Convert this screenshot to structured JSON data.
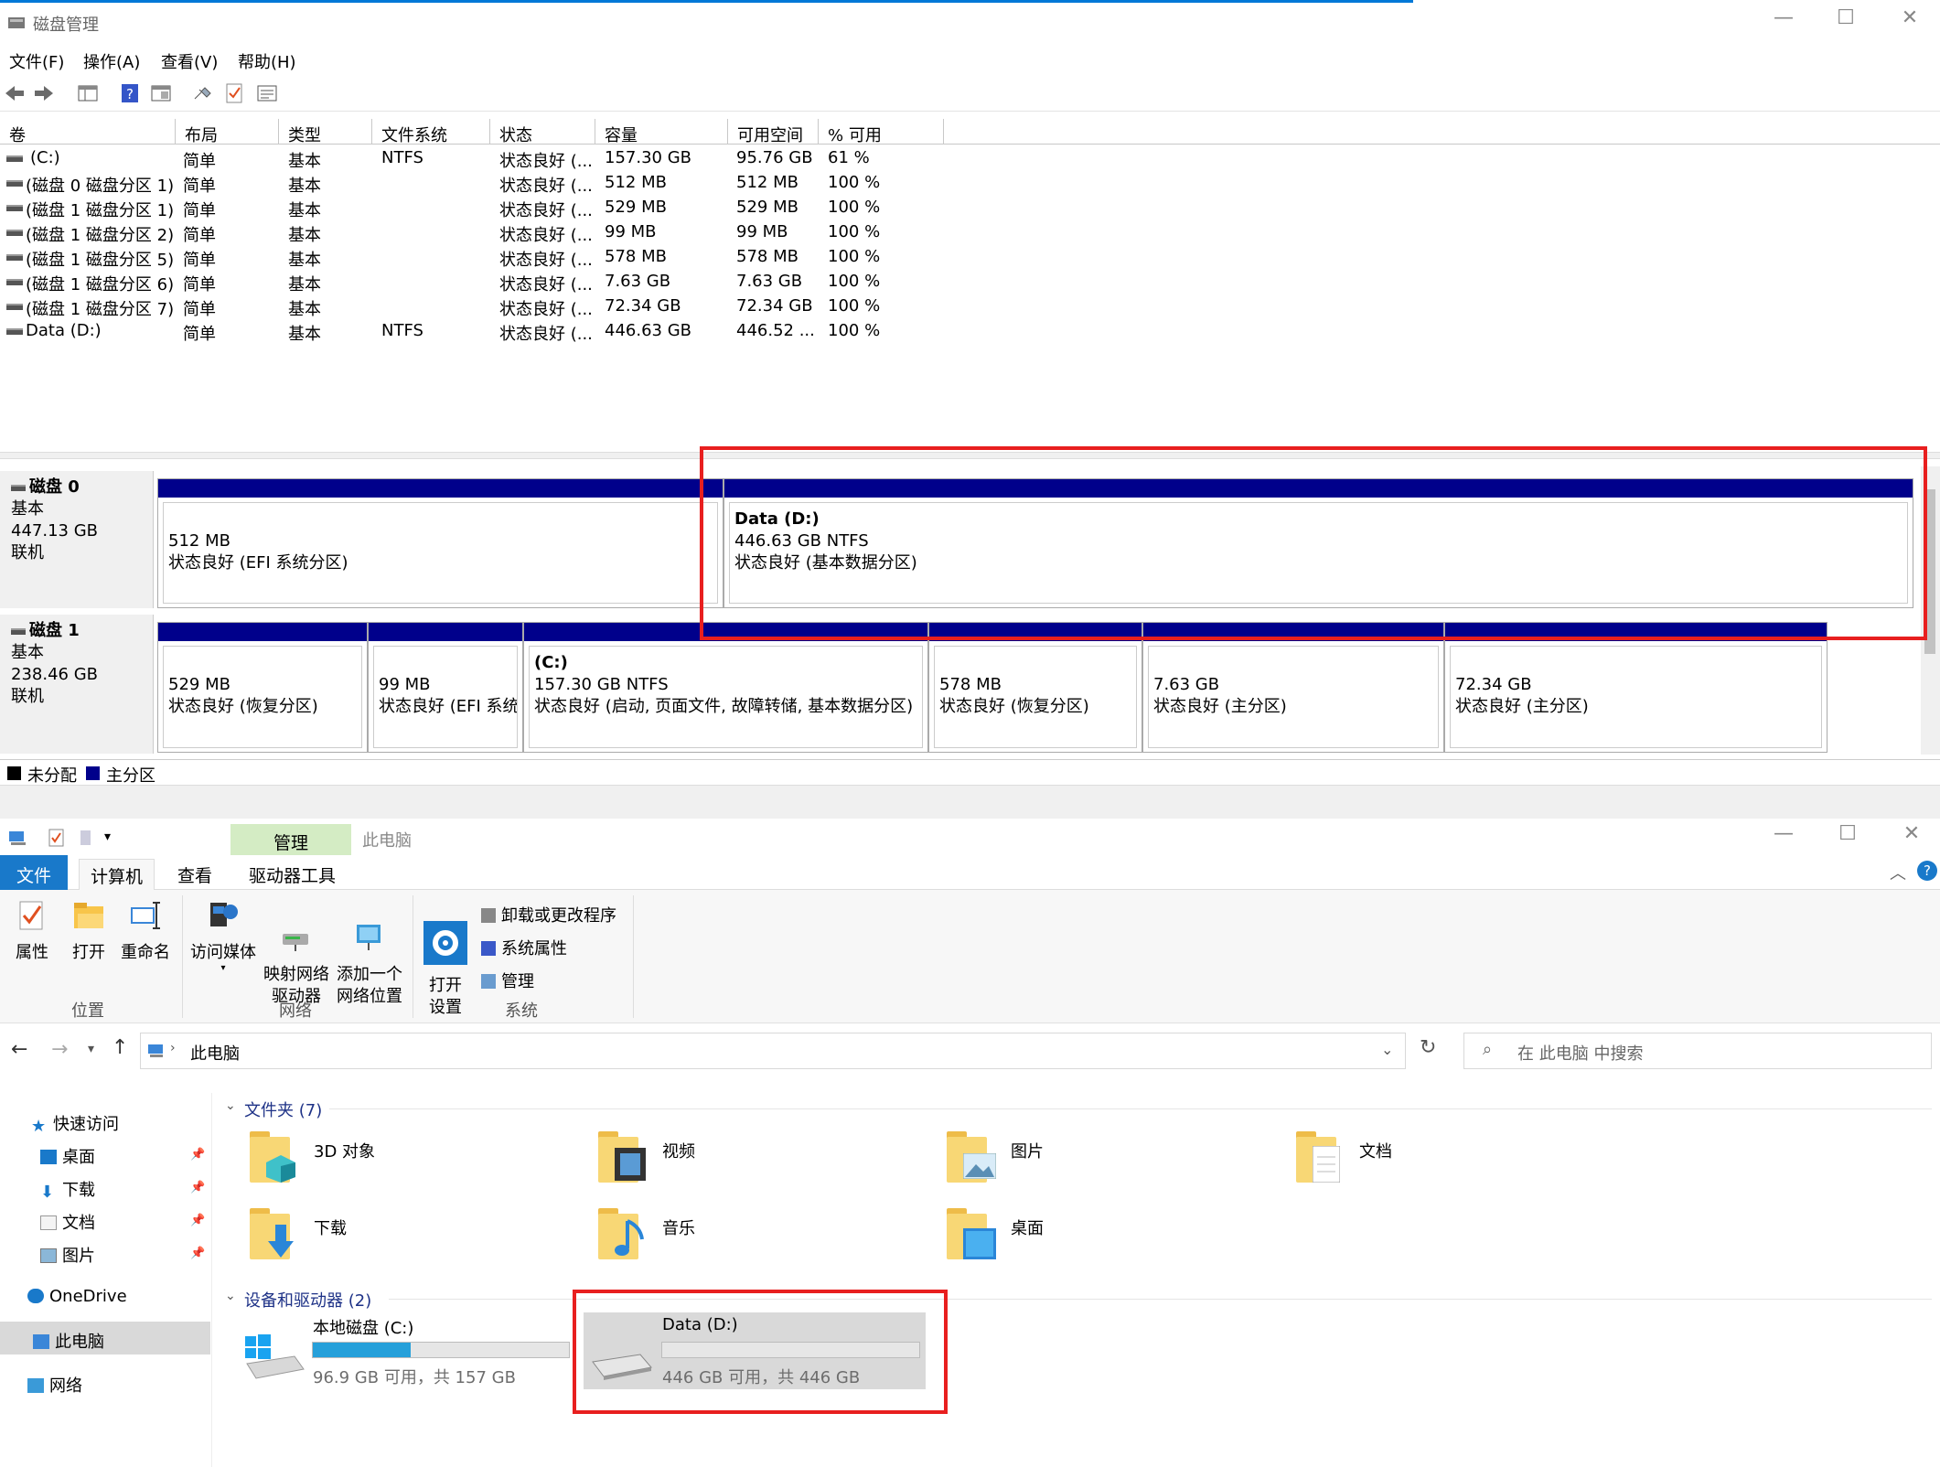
{
  "disk_mgmt": {
    "title": "磁盘管理",
    "menu": [
      "文件(F)",
      "操作(A)",
      "查看(V)",
      "帮助(H)"
    ],
    "columns": [
      "卷",
      "布局",
      "类型",
      "文件系统",
      "状态",
      "容量",
      "可用空间",
      "% 可用"
    ],
    "rows": [
      [
        "(C:)",
        "简单",
        "基本",
        "NTFS",
        "状态良好 (...",
        "157.30 GB",
        "95.76 GB",
        "61 %"
      ],
      [
        "(磁盘 0 磁盘分区 1)",
        "简单",
        "基本",
        "",
        "状态良好 (...",
        "512 MB",
        "512 MB",
        "100 %"
      ],
      [
        "(磁盘 1 磁盘分区 1)",
        "简单",
        "基本",
        "",
        "状态良好 (...",
        "529 MB",
        "529 MB",
        "100 %"
      ],
      [
        "(磁盘 1 磁盘分区 2)",
        "简单",
        "基本",
        "",
        "状态良好 (...",
        "99 MB",
        "99 MB",
        "100 %"
      ],
      [
        "(磁盘 1 磁盘分区 5)",
        "简单",
        "基本",
        "",
        "状态良好 (...",
        "578 MB",
        "578 MB",
        "100 %"
      ],
      [
        "(磁盘 1 磁盘分区 6)",
        "简单",
        "基本",
        "",
        "状态良好 (...",
        "7.63 GB",
        "7.63 GB",
        "100 %"
      ],
      [
        "(磁盘 1 磁盘分区 7)",
        "简单",
        "基本",
        "",
        "状态良好 (...",
        "72.34 GB",
        "72.34 GB",
        "100 %"
      ],
      [
        "Data (D:)",
        "简单",
        "基本",
        "NTFS",
        "状态良好 (...",
        "446.63 GB",
        "446.52 ...",
        "100 %"
      ]
    ],
    "disks": [
      {
        "name": "磁盘 0",
        "type": "基本",
        "size": "447.13 GB",
        "status": "联机",
        "partitions": [
          {
            "name": "",
            "size": "512 MB",
            "status": "状态良好 (EFI 系统分区)"
          },
          {
            "name": "Data  (D:)",
            "size": "446.63 GB NTFS",
            "status": "状态良好 (基本数据分区)"
          }
        ]
      },
      {
        "name": "磁盘 1",
        "type": "基本",
        "size": "238.46 GB",
        "status": "联机",
        "partitions": [
          {
            "name": "",
            "size": "529 MB",
            "status": "状态良好 (恢复分区)"
          },
          {
            "name": "",
            "size": "99 MB",
            "status": "状态良好 (EFI 系统"
          },
          {
            "name": "(C:)",
            "size": "157.30 GB NTFS",
            "status": "状态良好 (启动, 页面文件, 故障转储, 基本数据分区)"
          },
          {
            "name": "",
            "size": "578 MB",
            "status": "状态良好 (恢复分区)"
          },
          {
            "name": "",
            "size": "7.63 GB",
            "status": "状态良好 (主分区)"
          },
          {
            "name": "",
            "size": "72.34 GB",
            "status": "状态良好 (主分区)"
          }
        ]
      }
    ],
    "legend": [
      {
        "label": "未分配",
        "color": "#000000"
      },
      {
        "label": "主分区",
        "color": "#00008b"
      }
    ]
  },
  "explorer": {
    "context_tab": "管理",
    "window_title": "此电脑",
    "tabs": [
      "文件",
      "计算机",
      "查看",
      "驱动器工具"
    ],
    "ribbon": {
      "location": {
        "label": "位置",
        "buttons": [
          "属性",
          "打开",
          "重命名"
        ]
      },
      "network": {
        "label": "网络",
        "buttons": [
          "访问媒体",
          "映射网络\n驱动器",
          "添加一个\n网络位置"
        ]
      },
      "system": {
        "label": "系统",
        "open_settings": "打开\n设置",
        "items": [
          "卸载或更改程序",
          "系统属性",
          "管理"
        ]
      }
    },
    "address": "此电脑",
    "search_placeholder": "在 此电脑 中搜索",
    "nav": {
      "quick_access": "快速访问",
      "pinned": [
        "桌面",
        "下载",
        "文档",
        "图片"
      ],
      "onedrive": "OneDrive",
      "this_pc": "此电脑",
      "network": "网络"
    },
    "folders_header": "文件夹 (7)",
    "folders": [
      "3D 对象",
      "视频",
      "图片",
      "文档",
      "下载",
      "音乐",
      "桌面"
    ],
    "drives_header": "设备和驱动器 (2)",
    "drives": [
      {
        "name": "本地磁盘 (C:)",
        "free_text": "96.9 GB 可用，共 157 GB",
        "used_fraction": 0.383
      },
      {
        "name": "Data (D:)",
        "free_text": "446 GB 可用，共 446 GB",
        "used_fraction": 0.0
      }
    ]
  }
}
